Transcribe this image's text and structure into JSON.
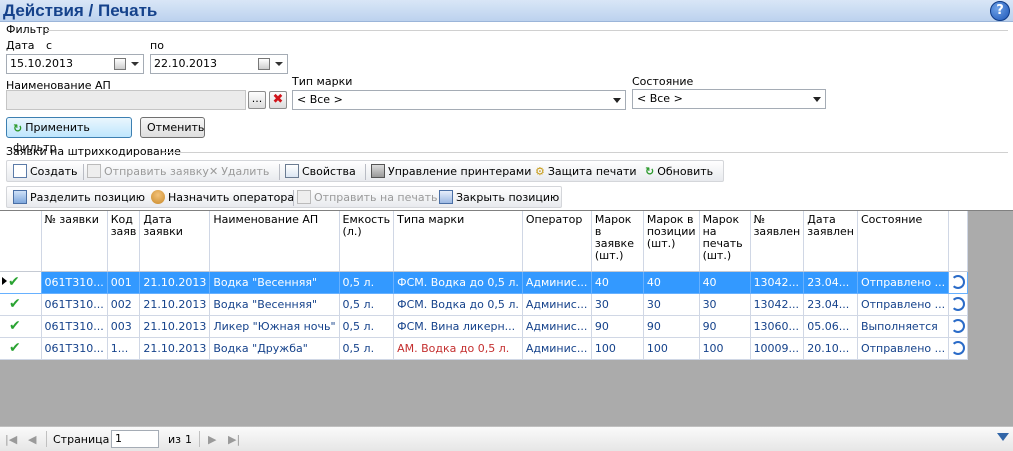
{
  "window": {
    "title": "Действия / Печать",
    "help": "?"
  },
  "filter": {
    "group_label": "Фильтр",
    "date_label": "Дата",
    "from_label": "с",
    "to_label": "по",
    "date_from": "15.10.2013",
    "date_to": "22.10.2013",
    "ap_label": "Наименование АП",
    "ap_value": "",
    "browse_label": "...",
    "clear_label": "✖",
    "mark_type_label": "Тип марки",
    "mark_type_value": "< Все >",
    "state_label": "Состояние",
    "state_value": "< Все >",
    "apply_label": "Применить фильтр",
    "cancel_label": "Отменить"
  },
  "requests": {
    "group_label": "Заявки на штрихкодирование",
    "toolbar1": {
      "create": "Создать",
      "send": "Отправить заявку",
      "delete": "Удалить",
      "properties": "Свойства",
      "printers": "Управление принтерами",
      "print_protect": "Защита печати",
      "refresh": "Обновить"
    },
    "toolbar2": {
      "split": "Разделить позицию",
      "assign": "Назначить оператора",
      "send_print": "Отправить на печать",
      "close": "Закрыть позицию"
    }
  },
  "grid": {
    "columns": [
      "№ заявки",
      "Код заяв",
      "Дата заявки",
      "Наименование АП",
      "Емкость (л.)",
      "Типа марки",
      "Оператор",
      "Марок в заявке (шт.)",
      "Марок в позиции (шт.)",
      "Марок на печать (шт.)",
      "№ заявлен",
      "Дата заявлен",
      "Состояние"
    ],
    "rows": [
      [
        "061T310...",
        "001",
        "21.10.2013",
        "Водка \"Весенняя\"",
        "0,5 л.",
        "ФСМ. Водка до 0,5 л.",
        "Админис...",
        "40",
        "40",
        "40",
        "13042...",
        "23.04...",
        "Отправлено ..."
      ],
      [
        "061T310...",
        "002",
        "21.10.2013",
        "Водка \"Весенняя\"",
        "0,5 л.",
        "ФСМ. Водка до 0,5 л.",
        "Админис...",
        "30",
        "30",
        "30",
        "13042...",
        "23.04...",
        "Отправлено ..."
      ],
      [
        "061T310...",
        "003",
        "21.10.2013",
        "Ликер \"Южная ночь\"",
        "0,5 л.",
        "ФСМ. Вина ликерн...",
        "Админис...",
        "90",
        "90",
        "90",
        "13060...",
        "05.06...",
        "Выполняется"
      ],
      [
        "061T310...",
        "1...",
        "21.10.2013",
        "Водка \"Дружба\"",
        "0,5 л.",
        "АМ. Водка до 0,5 л.",
        "Админис...",
        "100",
        "100",
        "100",
        "10009...",
        "20.10...",
        "Отправлено ..."
      ]
    ]
  },
  "pager": {
    "page_label": "Страница",
    "page_value": "1",
    "of_label": "из",
    "total": "1"
  }
}
